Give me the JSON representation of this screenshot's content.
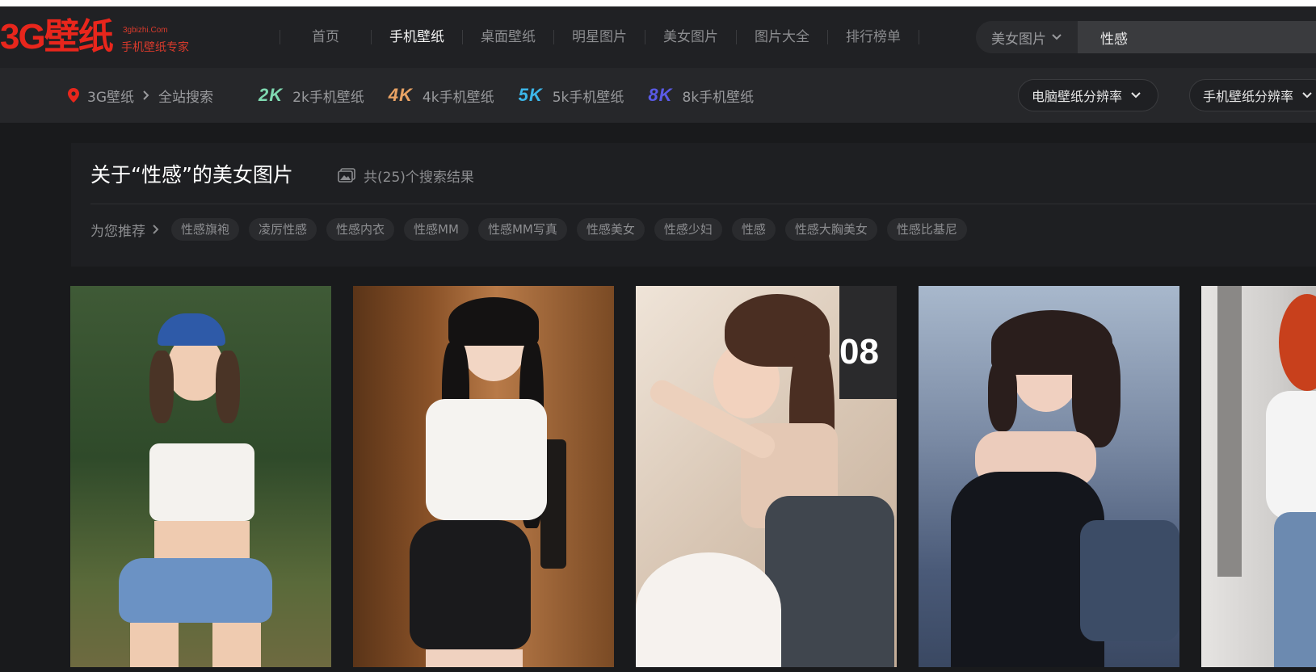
{
  "logo": {
    "main": "3G壁纸",
    "domain": "3gbizhi.Com",
    "slogan": "手机壁纸专家"
  },
  "nav": {
    "items": [
      {
        "label": "首页",
        "active": false
      },
      {
        "label": "手机壁纸",
        "active": true
      },
      {
        "label": "桌面壁纸",
        "active": false
      },
      {
        "label": "明星图片",
        "active": false
      },
      {
        "label": "美女图片",
        "active": false
      },
      {
        "label": "图片大全",
        "active": false
      },
      {
        "label": "排行榜单",
        "active": false
      }
    ]
  },
  "search": {
    "category": "美女图片",
    "value": "性感"
  },
  "breadcrumb": {
    "home": "3G壁纸",
    "current": "全站搜索"
  },
  "resolutions": [
    {
      "badge": "2K",
      "label": "2k手机壁纸",
      "color": "#7fd8b0"
    },
    {
      "badge": "4K",
      "label": "4k手机壁纸",
      "color": "#e8a264"
    },
    {
      "badge": "5K",
      "label": "5k手机壁纸",
      "color": "#3cb6e8"
    },
    {
      "badge": "8K",
      "label": "8k手机壁纸",
      "color": "#5a5ae6"
    }
  ],
  "filters": {
    "desktop": "电脑壁纸分辨率",
    "mobile": "手机壁纸分辨率"
  },
  "results": {
    "title": "关于“性感”的美女图片",
    "count": "共(25)个搜索结果",
    "recommend_label": "为您推荐",
    "tags": [
      "性感旗袍",
      "凌厉性感",
      "性感内衣",
      "性感MM",
      "性感MM写真",
      "性感美女",
      "性感少妇",
      "性感",
      "性感大胸美女",
      "性感比基尼"
    ]
  },
  "photo_clock": "08",
  "colors": {
    "accent_red": "#e8261c",
    "bg": "#191a1c"
  }
}
